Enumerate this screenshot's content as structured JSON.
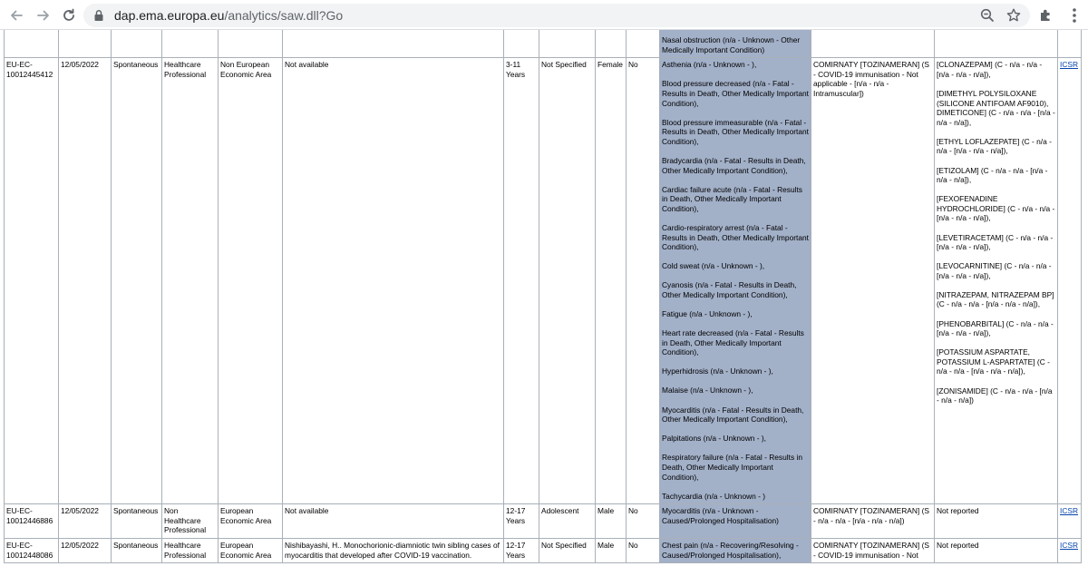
{
  "browser": {
    "url_domain": "dap.ema.europa.eu",
    "url_path": "/analytics/saw.dll?Go"
  },
  "rows": [
    {
      "id": "",
      "date": "",
      "type": "",
      "reporter": "",
      "region": "",
      "literature": "",
      "age": "",
      "age_group": "",
      "sex": "",
      "parent_child": "",
      "reactions": [
        "Medically Important Condition),",
        "Nasal obstruction (n/a - Unknown - Other Medically Important Condition)"
      ],
      "suspect": "",
      "concomitant": [],
      "link": ""
    },
    {
      "id": "EU-EC-10012445412",
      "date": "12/05/2022",
      "type": "Spontaneous",
      "reporter": "Healthcare Professional",
      "region": "Non European Economic Area",
      "literature": "Not available",
      "age": "3-11 Years",
      "age_group": "Not Specified",
      "sex": "Female",
      "parent_child": "No",
      "reactions": [
        "Asthenia (n/a - Unknown - ),",
        "Blood pressure decreased (n/a - Fatal - Results in Death, Other Medically Important Condition),",
        "Blood pressure immeasurable (n/a - Fatal - Results in Death, Other Medically Important Condition),",
        "Bradycardia (n/a - Fatal - Results in Death, Other Medically Important Condition),",
        "Cardiac failure acute (n/a - Fatal - Results in Death, Other Medically Important Condition),",
        "Cardio-respiratory arrest (n/a - Fatal - Results in Death, Other Medically Important Condition),",
        "Cold sweat (n/a - Unknown - ),",
        "Cyanosis (n/a - Fatal - Results in Death, Other Medically Important Condition),",
        "Fatigue (n/a - Unknown - ),",
        "Heart rate decreased (n/a - Fatal - Results in Death, Other Medically Important Condition),",
        "Hyperhidrosis (n/a - Unknown - ),",
        "Malaise (n/a - Unknown - ),",
        "Myocarditis (n/a - Fatal - Results in Death, Other Medically Important Condition),",
        "Palpitations (n/a - Unknown - ),",
        "Respiratory failure (n/a - Fatal - Results in Death, Other Medically Important Condition),",
        "Tachycardia (n/a - Unknown - )"
      ],
      "suspect": "COMIRNATY [TOZINAMERAN] (S - COVID-19 immunisation - Not applicable - [n/a - n/a - Intramuscular])",
      "concomitant": [
        "[CLONAZEPAM] (C - n/a - n/a - [n/a - n/a - n/a]),",
        "[DIMETHYL POLYSILOXANE (SILICONE ANTIFOAM AF9010), DIMETICONE] (C - n/a - n/a - [n/a - n/a - n/a]),",
        "[ETHYL LOFLAZEPATE] (C - n/a - n/a - [n/a - n/a - n/a]),",
        "[ETIZOLAM] (C - n/a - n/a - [n/a - n/a - n/a]),",
        "[FEXOFENADINE HYDROCHLORIDE] (C - n/a - n/a - [n/a - n/a - n/a]),",
        "[LEVETIRACETAM] (C - n/a - n/a - [n/a - n/a - n/a]),",
        "[LEVOCARNITINE] (C - n/a - n/a - [n/a - n/a - n/a]),",
        "[NITRAZEPAM, NITRAZEPAM BP] (C - n/a - n/a - [n/a - n/a - n/a]),",
        "[PHENOBARBITAL] (C - n/a - n/a - [n/a - n/a - n/a]),",
        "[POTASSIUM ASPARTATE, POTASSIUM L-ASPARTATE] (C - n/a - n/a - [n/a - n/a - n/a]),",
        "[ZONISAMIDE] (C - n/a - n/a - [n/a - n/a - n/a])"
      ],
      "link": "ICSR"
    },
    {
      "id": "EU-EC-10012446886",
      "date": "12/05/2022",
      "type": "Spontaneous",
      "reporter": "Non Healthcare Professional",
      "region": "European Economic Area",
      "literature": "Not available",
      "age": "12-17 Years",
      "age_group": "Adolescent",
      "sex": "Male",
      "parent_child": "No",
      "reactions": [
        "Myocarditis (n/a - Unknown - Caused/Prolonged Hospitalisation)"
      ],
      "suspect": "COMIRNATY [TOZINAMERAN] (S - n/a - n/a - [n/a - n/a - n/a])",
      "concomitant": [
        "Not reported"
      ],
      "link": "ICSR"
    },
    {
      "id": "EU-EC-10012448086",
      "date": "12/05/2022",
      "type": "Spontaneous",
      "reporter": "Healthcare Professional",
      "region": "European Economic Area",
      "literature": "Nishibayashi, H.. Monochorionic-diamniotic twin sibling cases of myocarditis that developed after COVID-19 vaccination.",
      "age": "12-17 Years",
      "age_group": "Not Specified",
      "sex": "Male",
      "parent_child": "No",
      "reactions": [
        "Chest pain (n/a - Recovering/Resolving - Caused/Prolonged Hospitalisation),"
      ],
      "suspect": "COMIRNATY [TOZINAMERAN] (S - COVID-19 immunisation - Not",
      "concomitant": [
        "Not reported"
      ],
      "link": "ICSR"
    }
  ]
}
